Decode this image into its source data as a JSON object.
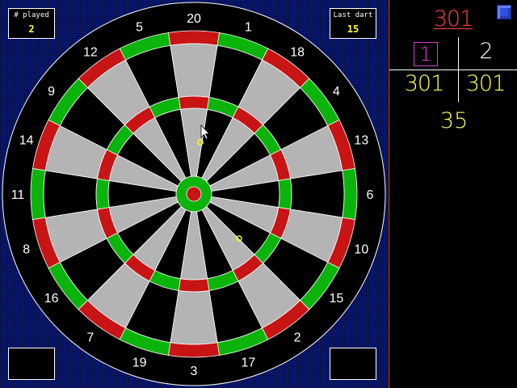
{
  "board": {
    "numbers": [
      "20",
      "1",
      "18",
      "4",
      "13",
      "6",
      "10",
      "15",
      "2",
      "17",
      "3",
      "19",
      "7",
      "16",
      "8",
      "11",
      "14",
      "9",
      "12",
      "5"
    ],
    "colors": {
      "background": "#0a1a7a",
      "light_segment": "#b4b4b4",
      "dark_segment": "#000000",
      "red_ring": "#c81414",
      "green_ring": "#0ab40a",
      "wire": "#ffffff",
      "dart_marker": "#ffff00"
    }
  },
  "played": {
    "label": "# played",
    "value": "2"
  },
  "last_dart": {
    "label": "Last dart",
    "value": "15"
  },
  "panel": {
    "game_title": "301",
    "players": [
      "1",
      "2"
    ],
    "active_player": "1",
    "scores": [
      "301",
      "301"
    ],
    "remaining": "35"
  }
}
